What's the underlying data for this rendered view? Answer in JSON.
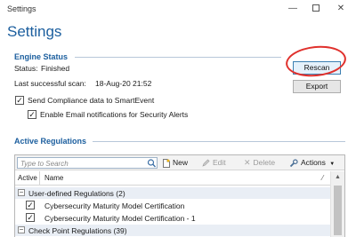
{
  "window": {
    "title": "Settings",
    "minimize_glyph": "—",
    "close_glyph": "✕"
  },
  "page_title": "Settings",
  "engine_status": {
    "section_title": "Engine Status",
    "status_label": "Status:",
    "status_value": "Finished",
    "last_scan_label": "Last successful scan:",
    "last_scan_value": "18-Aug-20 21:52",
    "rescan_label": "Rescan",
    "export_label": "Export",
    "send_compliance_label": "Send Compliance data to SmartEvent",
    "send_compliance_checked": true,
    "email_notifications_label": "Enable Email notifications for Security Alerts",
    "email_notifications_checked": true
  },
  "active_regulations": {
    "section_title": "Active Regulations",
    "search_placeholder": "Type to Search",
    "toolbar": {
      "new_label": "New",
      "edit_label": "Edit",
      "delete_label": "Delete",
      "actions_label": "Actions"
    },
    "columns": {
      "active": "Active",
      "name": "Name"
    },
    "groups": [
      {
        "label": "User-defined Regulations (2)",
        "expanded": true,
        "items": [
          {
            "name": "Cybersecurity Maturity Model Certification",
            "active": true
          },
          {
            "name": "Cybersecurity Maturity Model Certification - 1",
            "active": true
          }
        ]
      },
      {
        "label": "Check Point Regulations (39)",
        "expanded": true,
        "items": []
      }
    ]
  },
  "colors": {
    "accent": "#1b5e9e",
    "annotation": "#e0302c",
    "group_row_bg": "#e9eef5"
  }
}
